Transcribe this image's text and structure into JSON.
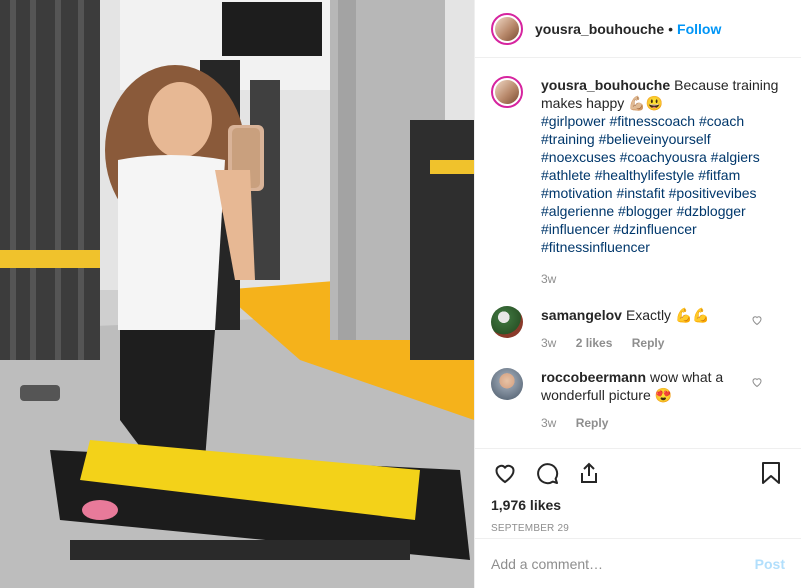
{
  "header": {
    "username": "yousra_bouhouche",
    "separator": "•",
    "follow": "Follow"
  },
  "caption": {
    "username": "yousra_bouhouche",
    "text": "Because training makes happy 💪🏼😃",
    "hashtags": "#girlpower #fitnesscoach #coach #training #believeinyourself #noexcuses #coachyousra #algiers #athlete #healthylifestyle #fitfam #motivation #instafit #positivevibes #algerienne #blogger #dzblogger #influencer #dzinfluencer #fitnessinfluencer",
    "age": "3w"
  },
  "comments": [
    {
      "username": "samangelov",
      "text": "Exactly 💪💪",
      "age": "3w",
      "likes": "2 likes",
      "reply": "Reply"
    },
    {
      "username": "roccobeermann",
      "text": "wow what a wonderfull picture 😍",
      "age": "3w",
      "reply": "Reply"
    }
  ],
  "actions": {
    "likes": "1,976 likes",
    "date": "SEPTEMBER 29"
  },
  "add_comment": {
    "placeholder": "Add a comment…",
    "post": "Post"
  },
  "icons": [
    "heart-icon",
    "comment-icon",
    "share-icon",
    "bookmark-icon",
    "small-heart-icon"
  ]
}
